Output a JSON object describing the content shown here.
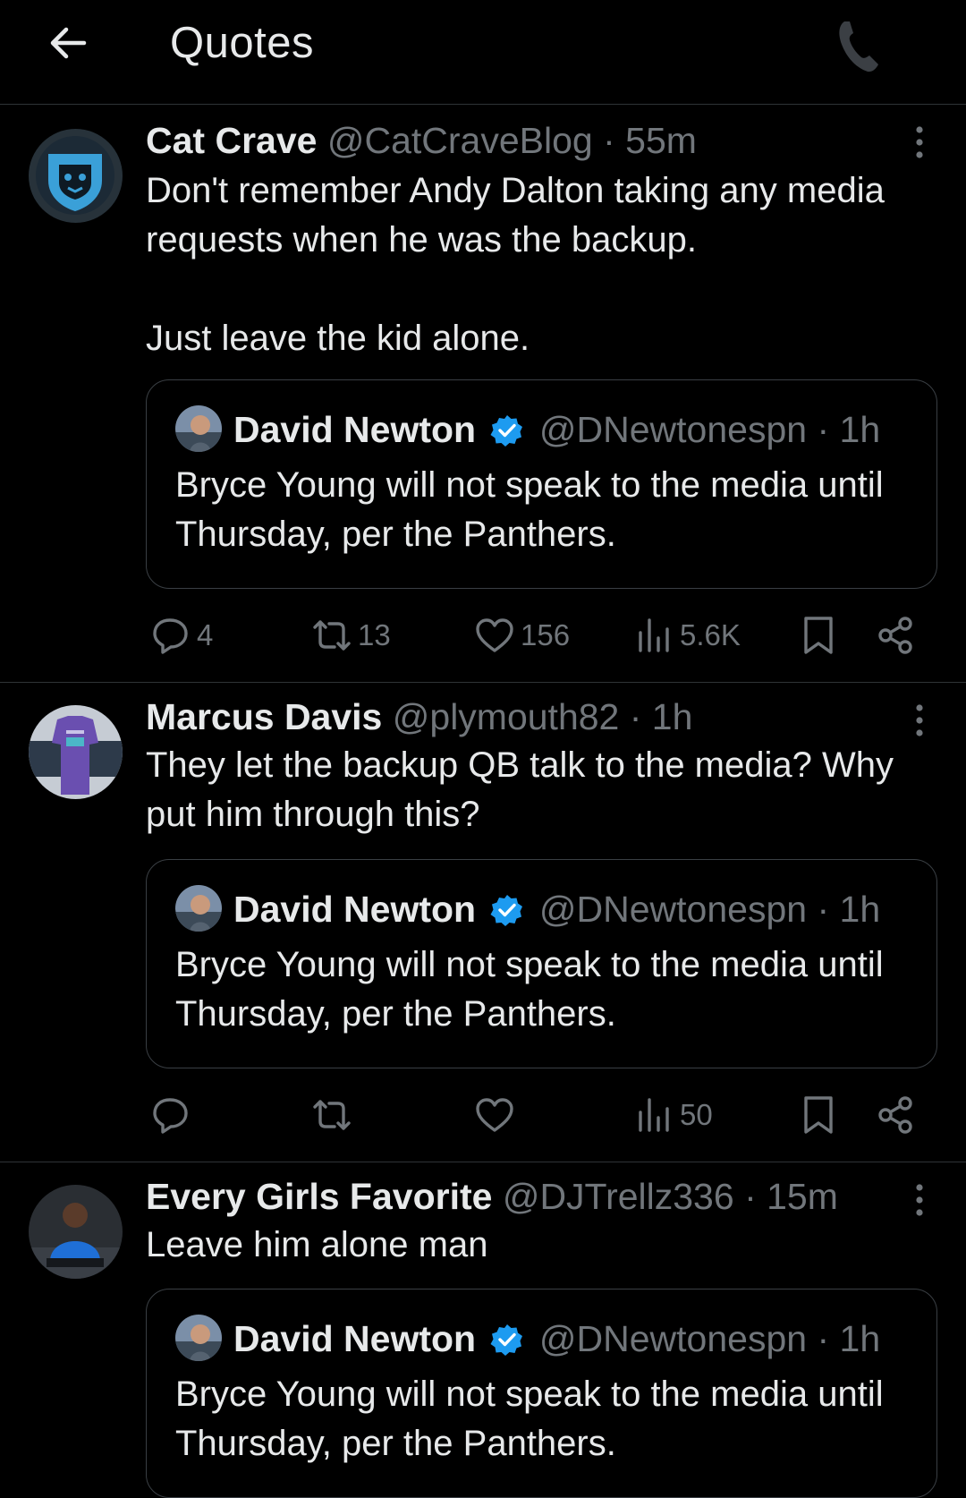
{
  "header": {
    "title": "Quotes"
  },
  "quoted": {
    "name": "David Newton",
    "handle": "@DNewtonespn",
    "time": "· 1h",
    "text": "Bryce Young will not speak to the media until Thursday, per the Panthers."
  },
  "tweets": [
    {
      "name": "Cat Crave",
      "handle": "@CatCraveBlog",
      "time": "· 55m",
      "text": "Don't remember Andy Dalton taking any media requests when he was the backup.\n\nJust leave the kid alone.",
      "replies": "4",
      "reposts": "13",
      "likes": "156",
      "views": "5.6K"
    },
    {
      "name": "Marcus Davis",
      "handle": "@plymouth82",
      "time": "· 1h",
      "text": "They let the backup QB talk to the media? Why put him through this?",
      "replies": "",
      "reposts": "",
      "likes": "",
      "views": "50"
    },
    {
      "name": "Every Girls Favorite",
      "handle": "@DJTrellz336",
      "time": "· 15m",
      "text": "Leave him alone man"
    }
  ],
  "colors": {
    "background": "#000000",
    "text": "#e7e9ea",
    "muted": "#71767b",
    "verified": "#1d9bf0",
    "divider": "#2f3336"
  },
  "icons": [
    "back-arrow-icon",
    "phone-icon",
    "more-icon",
    "reply-icon",
    "repost-icon",
    "like-icon",
    "views-icon",
    "bookmark-icon",
    "share-icon",
    "verified-badge-icon"
  ]
}
